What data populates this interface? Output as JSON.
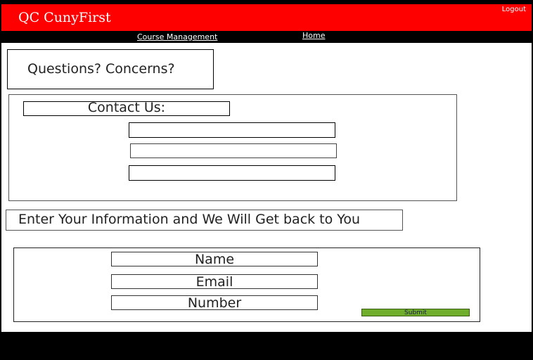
{
  "header": {
    "title": "QC CunyFirst",
    "logout_label": "Logout",
    "color": "#ff0000"
  },
  "nav": {
    "course_management_label": "Course Management",
    "home_label": "Home"
  },
  "questions": {
    "label": "Questions? Concerns?"
  },
  "contact": {
    "label": "Contact Us:",
    "fields": [
      "",
      "",
      ""
    ]
  },
  "info_banner": {
    "text": "Enter Your Information and We Will Get back to You"
  },
  "form": {
    "name_placeholder": "Name",
    "email_placeholder": "Email",
    "number_placeholder": "Number",
    "submit_label": "Submit",
    "submit_color": "#6fae2a"
  }
}
